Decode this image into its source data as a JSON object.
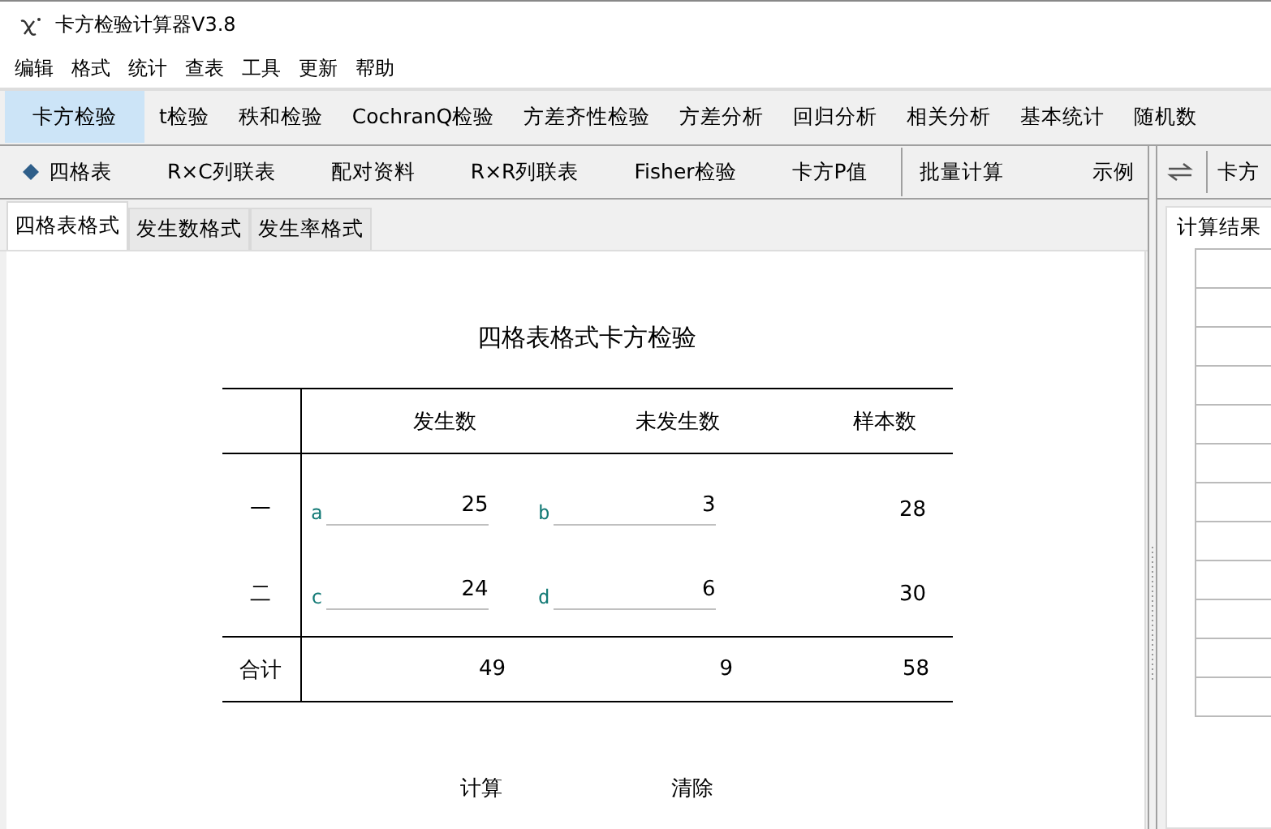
{
  "window": {
    "title": "卡方检验计算器V3.8"
  },
  "menu": [
    "编辑",
    "格式",
    "统计",
    "查表",
    "工具",
    "更新",
    "帮助"
  ],
  "main_tabs": [
    {
      "label": "卡方检验",
      "selected": true
    },
    {
      "label": "t检验",
      "selected": false
    },
    {
      "label": "秩和检验",
      "selected": false
    },
    {
      "label": "CochranQ检验",
      "selected": false
    },
    {
      "label": "方差齐性检验",
      "selected": false
    },
    {
      "label": "方差分析",
      "selected": false
    },
    {
      "label": "回归分析",
      "selected": false
    },
    {
      "label": "相关分析",
      "selected": false
    },
    {
      "label": "基本统计",
      "selected": false
    },
    {
      "label": "随机数",
      "selected": false
    }
  ],
  "sub_tabs": [
    {
      "label": "四格表",
      "selected": true
    },
    {
      "label": "R×C列联表",
      "selected": false
    },
    {
      "label": "配对资料",
      "selected": false
    },
    {
      "label": "R×R列联表",
      "selected": false
    },
    {
      "label": "Fisher检验",
      "selected": false
    },
    {
      "label": "卡方P值",
      "selected": false
    }
  ],
  "toolbar_buttons": [
    "批量计算",
    "示例"
  ],
  "format_tabs": [
    {
      "label": "四格表格式",
      "selected": true
    },
    {
      "label": "发生数格式",
      "selected": false
    },
    {
      "label": "发生率格式",
      "selected": false
    }
  ],
  "form": {
    "title": "四格表格式卡方检验",
    "columns": [
      "发生数",
      "未发生数",
      "样本数"
    ],
    "rows": [
      {
        "label": "一",
        "cells": [
          {
            "tag": "a",
            "value": "25"
          },
          {
            "tag": "b",
            "value": "3"
          }
        ],
        "total": "28"
      },
      {
        "label": "二",
        "cells": [
          {
            "tag": "c",
            "value": "24"
          },
          {
            "tag": "d",
            "value": "6"
          }
        ],
        "total": "30"
      }
    ],
    "total_row": {
      "label": "合计",
      "values": [
        "49",
        "9",
        "58"
      ]
    },
    "buttons": [
      "计算",
      "清除"
    ]
  },
  "right_panel": {
    "tab": "卡方",
    "results_title": "计算结果"
  }
}
